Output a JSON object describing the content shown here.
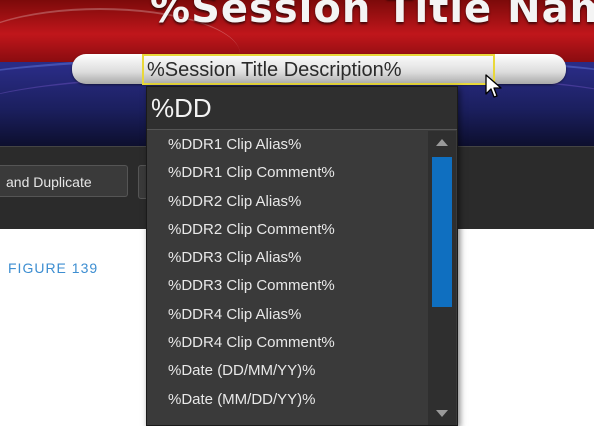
{
  "banner": {
    "title": "%Session Title Name%",
    "description": "%Session Title Description%"
  },
  "toolbar": {
    "button_label": "and Duplicate"
  },
  "figure_label": "FIGURE 139",
  "dropdown": {
    "query": "%DD",
    "items": [
      "%DDR1 Clip Alias%",
      "%DDR1 Clip Comment%",
      "%DDR2 Clip Alias%",
      "%DDR2 Clip Comment%",
      "%DDR3 Clip Alias%",
      "%DDR3 Clip Comment%",
      "%DDR4 Clip Alias%",
      "%DDR4 Clip Comment%",
      "%Date (DD/MM/YY)%",
      "%Date (MM/DD/YY)%"
    ]
  },
  "colors": {
    "accent_scroll_thumb": "#0f6fc0",
    "field_highlight": "#e9d83a",
    "figure_label": "#3d8ed1",
    "dropdown_bg": "#3a3a3a"
  },
  "icons": [
    "mouse-pointer-icon",
    "scroll-up-arrow-icon",
    "scroll-down-arrow-icon"
  ]
}
